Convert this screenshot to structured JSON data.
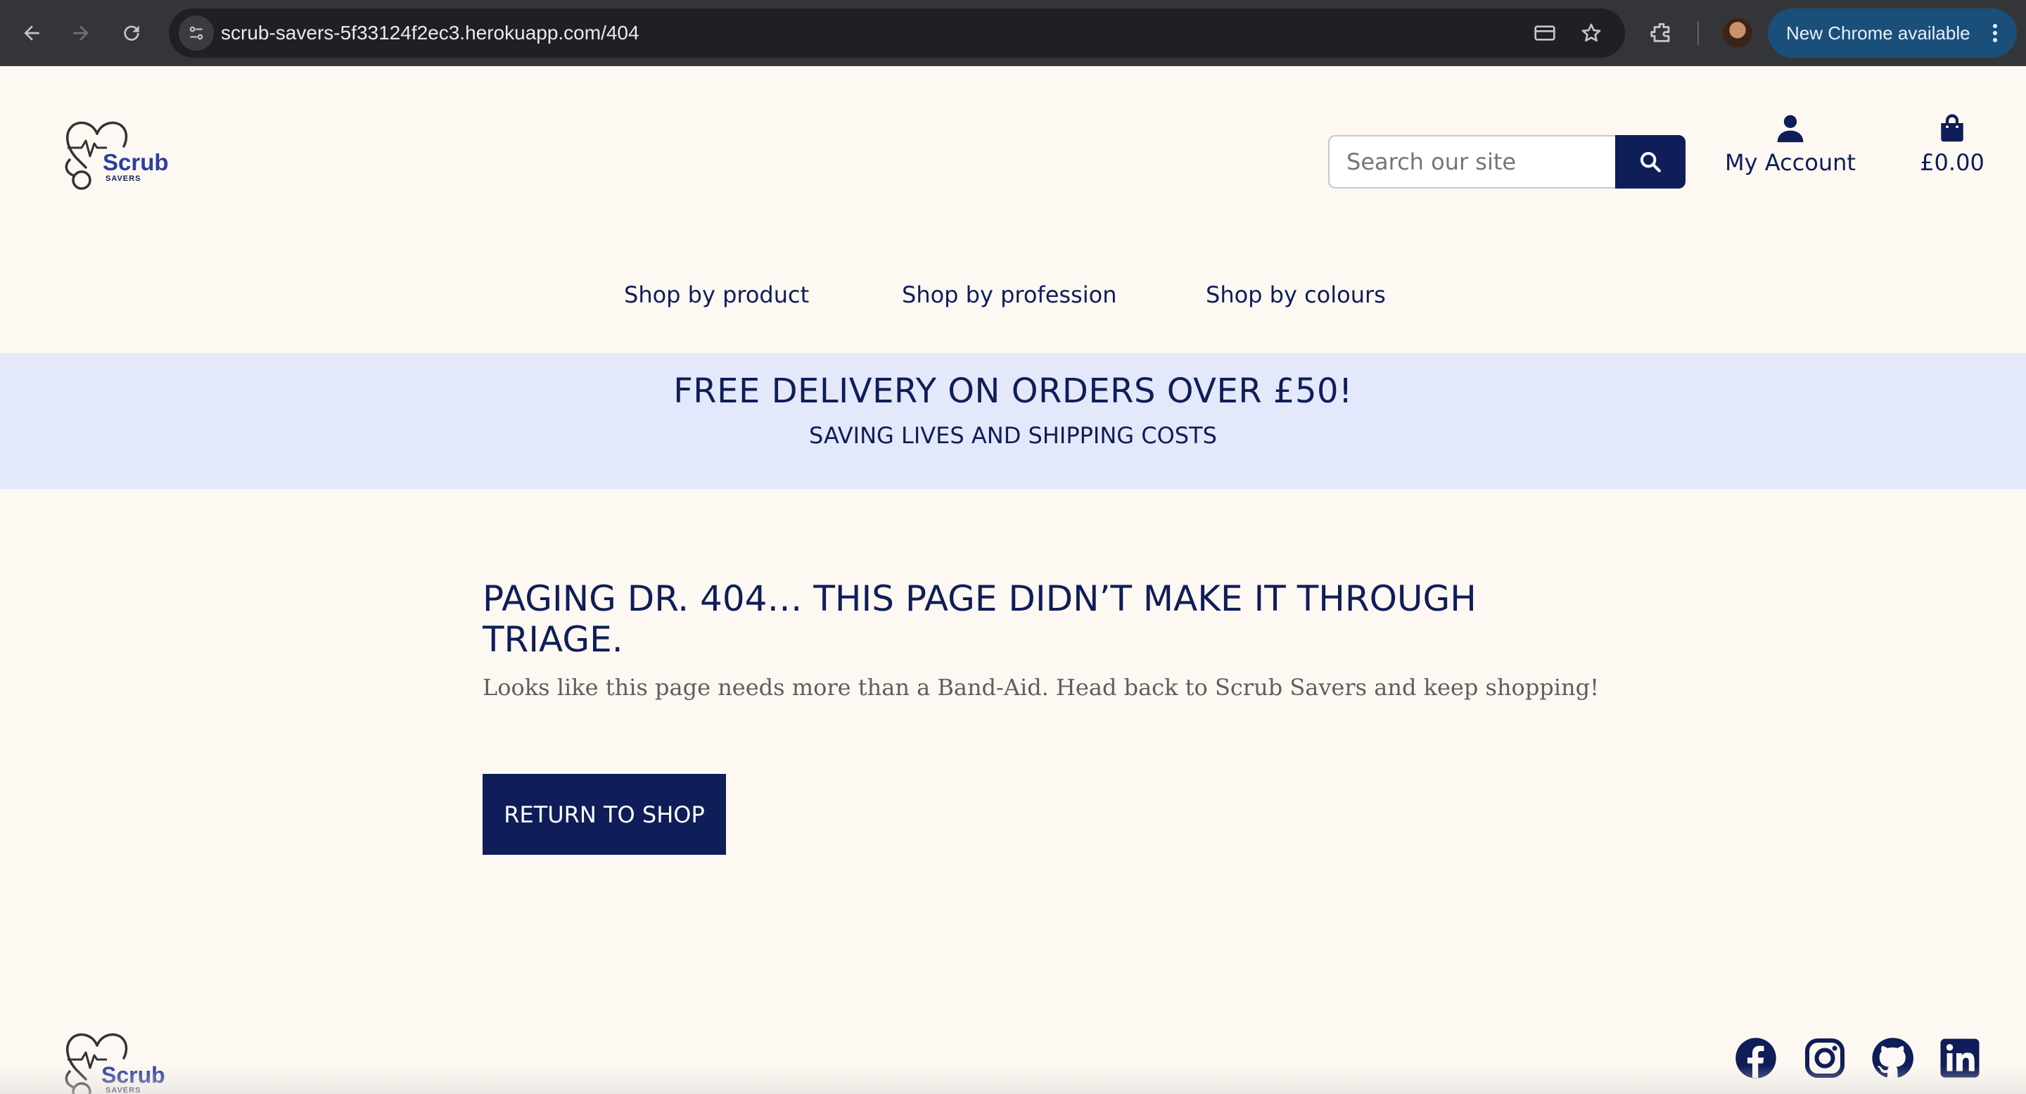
{
  "browser": {
    "url": "scrub-savers-5f33124f2ec3.herokuapp.com/404",
    "update_label": "New Chrome available",
    "icons": [
      "back-arrow-icon",
      "forward-arrow-icon",
      "reload-icon",
      "site-info-icon",
      "card-icon",
      "star-icon",
      "extensions-icon",
      "profile-avatar",
      "menu-kebab-icon"
    ]
  },
  "header": {
    "logo_word": "Scrub",
    "logo_sub": "SAVERS",
    "search_placeholder": "Search our site",
    "account_label": "My Account",
    "cart_total": "£0.00"
  },
  "nav": {
    "items": [
      {
        "label": "Shop by product"
      },
      {
        "label": "Shop by profession"
      },
      {
        "label": "Shop by colours"
      }
    ]
  },
  "banner": {
    "title": "FREE DELIVERY ON ORDERS OVER £50!",
    "subtitle": "SAVING LIVES AND SHIPPING COSTS"
  },
  "error": {
    "heading": "PAGING DR. 404… THIS PAGE DIDN’T MAKE IT THROUGH TRIAGE.",
    "message": "Looks like this page needs more than a Band-Aid. Head back to Scrub Savers and keep shopping!",
    "button_label": "RETURN TO SHOP"
  },
  "footer": {
    "logo_word": "Scrub",
    "logo_sub": "SAVERS",
    "social": [
      "facebook-icon",
      "instagram-icon",
      "github-icon",
      "linkedin-icon"
    ]
  },
  "colors": {
    "brand_navy": "#0f1d58",
    "brand_blue": "#2b3f9e",
    "page_bg": "#fdf8f2",
    "banner_bg": "#e3e9fa",
    "chrome_bg": "#343538",
    "update_pill": "#1a4f7a"
  }
}
